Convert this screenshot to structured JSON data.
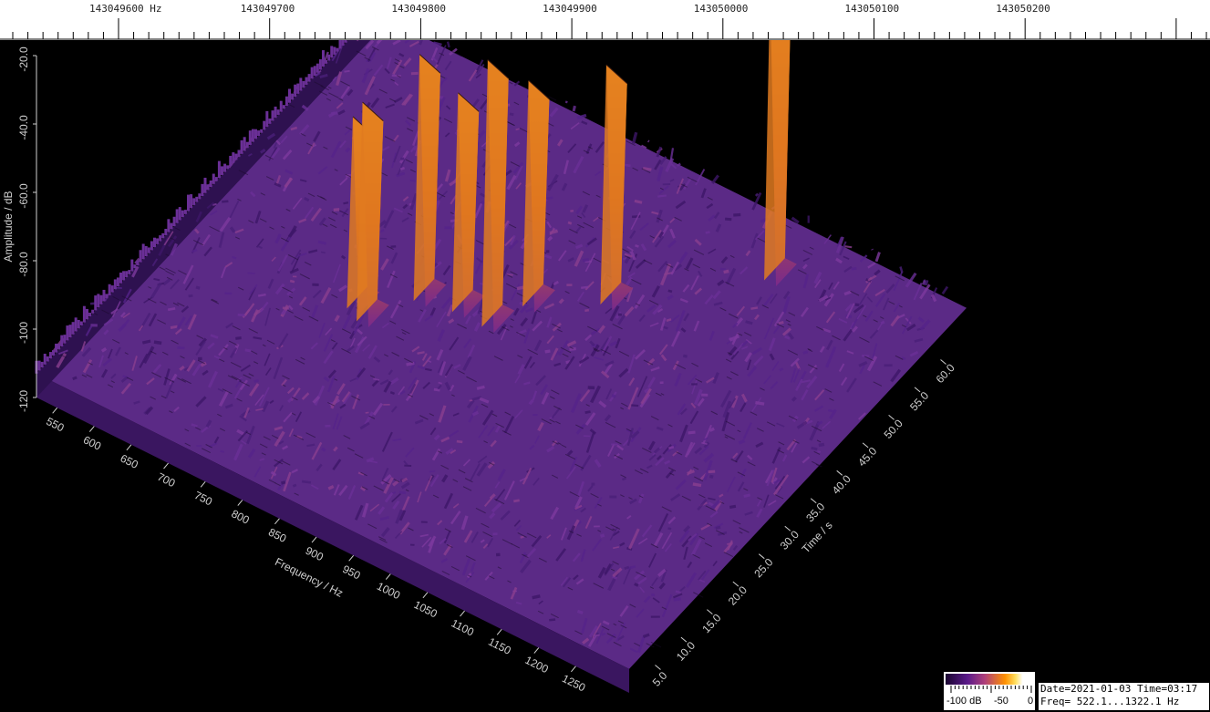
{
  "ruler": {
    "labels": [
      "143049600 Hz",
      "143049700",
      "143049800",
      "143049900",
      "143050000",
      "143050100",
      "143050200"
    ]
  },
  "chart_data": {
    "type": "surface-3d-waterfall",
    "colormap": [
      "#1a0530",
      "#5a1a8a",
      "#b0407a",
      "#ff9000",
      "#ffe060",
      "#ffffff"
    ],
    "amplitude_axis": {
      "label": "Amplitude / dB",
      "ticks": [
        "-20.0",
        "-40.0",
        "-60.0",
        "-80.0",
        "-100",
        "-120"
      ]
    },
    "frequency_axis": {
      "label": "Frequency / Hz",
      "range": [
        522.1,
        1322.1
      ],
      "ticks": [
        "550",
        "600",
        "650",
        "700",
        "750",
        "800",
        "850",
        "900",
        "950",
        "1000",
        "1050",
        "1100",
        "1150",
        "1200",
        "1250"
      ]
    },
    "time_axis": {
      "label": "Time / s",
      "range": [
        0,
        65
      ],
      "ticks": [
        "5.0",
        "10.0",
        "15.0",
        "20.0",
        "25.0",
        "30.0",
        "35.0",
        "40.0",
        "45.0",
        "50.0",
        "55.0",
        "60.0"
      ]
    },
    "peaks": [
      {
        "freq_hz": 780,
        "time_s": 30,
        "level_db": -60
      },
      {
        "freq_hz": 760,
        "time_s": 31,
        "level_db": -68
      },
      {
        "freq_hz": 815,
        "time_s": 36,
        "level_db": -52
      },
      {
        "freq_hz": 860,
        "time_s": 37,
        "level_db": -60
      },
      {
        "freq_hz": 900,
        "time_s": 37,
        "level_db": -46
      },
      {
        "freq_hz": 920,
        "time_s": 42,
        "level_db": -58
      },
      {
        "freq_hz": 990,
        "time_s": 47,
        "level_db": -54
      },
      {
        "freq_hz": 1120,
        "time_s": 60,
        "level_db": -38
      }
    ]
  },
  "legend": {
    "min_label": "-100 dB",
    "mid_label": "-50",
    "max_label": "0"
  },
  "info": {
    "line1": "Date=2021-01-03 Time=03:17",
    "line2": "Freq= 522.1...1322.1 Hz"
  }
}
